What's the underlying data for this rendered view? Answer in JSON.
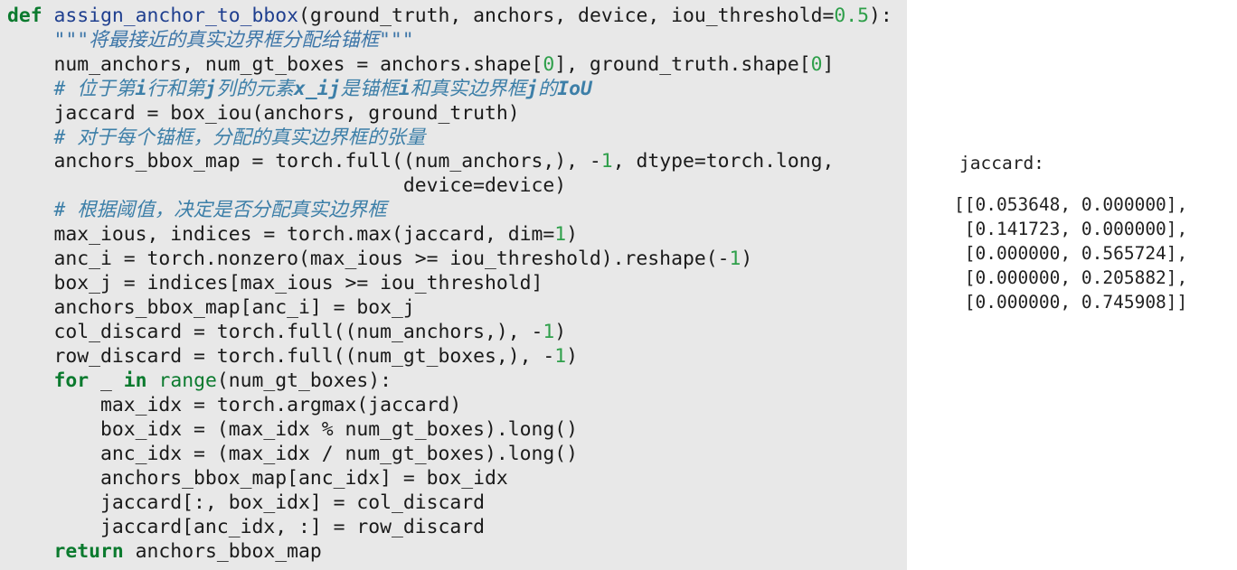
{
  "code": {
    "l01_def": "def",
    "l01_fn": "assign_anchor_to_bbox",
    "l01_a": "(ground_truth, anchors, device, iou_threshold=",
    "l01_num": "0.5",
    "l01_b": "):",
    "l02_doc": "\"\"\"将最接近的真实边界框分配给锚框\"\"\"",
    "l03_a": "num_anchors, num_gt_boxes = anchors.shape[",
    "l03_n1": "0",
    "l03_b": "], ground_truth.shape[",
    "l03_n2": "0",
    "l03_c": "]",
    "l04_a": "# 位于第",
    "l04_b": "i",
    "l04_c": "行和第",
    "l04_d": "j",
    "l04_e": "列的元素",
    "l04_f": "x_ij",
    "l04_g": "是锚框",
    "l04_h": "i",
    "l04_i": "和真实边界框",
    "l04_j": "j",
    "l04_k": "的",
    "l04_l": "IoU",
    "l05": "jaccard = box_iou(anchors, ground_truth)",
    "l06_cmt": "# 对于每个锚框，分配的真实边界框的张量",
    "l07_a": "anchors_bbox_map = torch.full((num_anchors,), -",
    "l07_n": "1",
    "l07_b": ", dtype=torch.long,",
    "l08": "device=device)",
    "l09_cmt": "# 根据阈值，决定是否分配真实边界框",
    "l10_a": "max_ious, indices = torch.max(jaccard, dim=",
    "l10_n": "1",
    "l10_b": ")",
    "l11_a": "anc_i = torch.nonzero(max_ious >= iou_threshold).reshape(-",
    "l11_n": "1",
    "l11_b": ")",
    "l12": "box_j = indices[max_ious >= iou_threshold]",
    "l13": "anchors_bbox_map[anc_i] = box_j",
    "l14_a": "col_discard = torch.full((num_anchors,), -",
    "l14_n": "1",
    "l14_b": ")",
    "l15_a": "row_discard = torch.full((num_gt_boxes,), -",
    "l15_n": "1",
    "l15_b": ")",
    "l16_for": "for",
    "l16_mid": " _ ",
    "l16_in": "in",
    "l16_range": "range",
    "l16_b": "(num_gt_boxes):",
    "l17": "max_idx = torch.argmax(jaccard)",
    "l18": "box_idx = (max_idx % num_gt_boxes).long()",
    "l19": "anc_idx = (max_idx / num_gt_boxes).long()",
    "l20": "anchors_bbox_map[anc_idx] = box_idx",
    "l21": "jaccard[:, box_idx] = col_discard",
    "l22": "jaccard[anc_idx, :] = row_discard",
    "l23_kw": "return",
    "l23_b": " anchors_bbox_map"
  },
  "output": {
    "label": "jaccard:",
    "rows": [
      "[[0.053648, 0.000000],",
      " [0.141723, 0.000000],",
      " [0.000000, 0.565724],",
      " [0.000000, 0.205882],",
      " [0.000000, 0.745908]]"
    ]
  },
  "colors": {
    "keyword": "#0b7a2e",
    "function_name": "#1f3f8f",
    "number": "#2e9f4a",
    "comment": "#3d7fa8",
    "code_background": "#e8e8e8"
  }
}
